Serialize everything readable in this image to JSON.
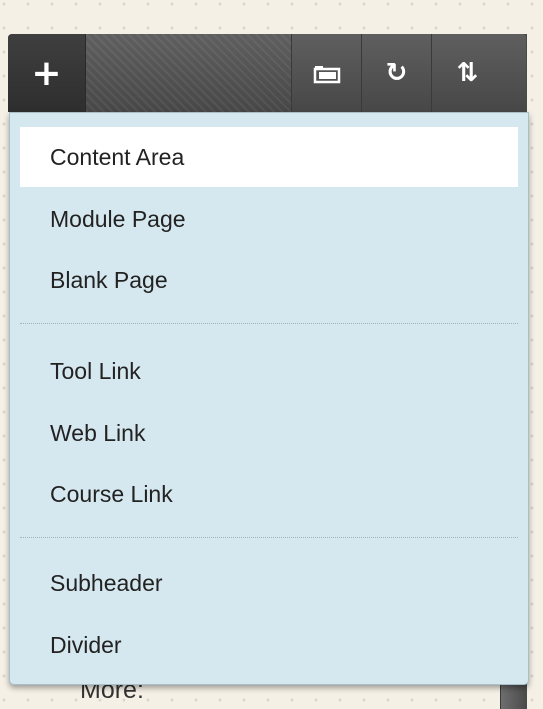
{
  "toolbar": {
    "add_glyph": "+",
    "refresh_glyph": "↻",
    "sort_glyph": "⇅",
    "icons": [
      "plus-icon",
      "folder-icon",
      "refresh-icon",
      "sort-icon"
    ]
  },
  "menu": {
    "groups": [
      {
        "items": [
          "Content Area",
          "Module Page",
          "Blank Page"
        ]
      },
      {
        "items": [
          "Tool Link",
          "Web Link",
          "Course Link"
        ]
      },
      {
        "items": [
          "Subheader",
          "Divider"
        ]
      }
    ],
    "highlighted_item": "Content Area"
  },
  "behind": {
    "more_text": "More:"
  },
  "colors": {
    "menu_bg": "#d6e8ef",
    "toolbar_bg": "#4f4f4f",
    "highlight_bg": "#ffffff"
  }
}
